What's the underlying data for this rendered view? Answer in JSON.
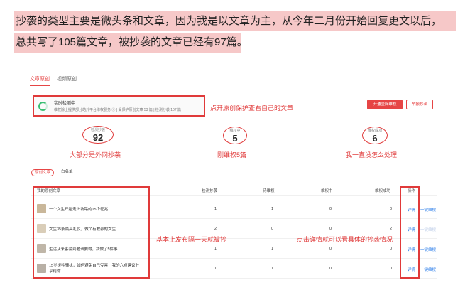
{
  "intro": {
    "line1": "抄袭的类型主要是微头条和文章，因为我是以文章为主，从今年二月份开始回复更文以后，",
    "line2": "总共写了105篇文章，被抄袭的文章已经有97篇。"
  },
  "tabs": [
    {
      "label": "文章原创",
      "active": true
    },
    {
      "label": "视频原创",
      "active": false
    }
  ],
  "monitor": {
    "title": "实时检测中",
    "desc": "维权除上提供部分站外平台维权服务 ⓘ  |  受保护原创文章 53 篇  |  检测抄袭 107 篇"
  },
  "annotations": {
    "top_right": "点开原创保护查看自己的文章",
    "stat1": "大部分是外网抄袭",
    "stat2": "刚维权5篇",
    "stat3": "我一直没怎么处理",
    "table_mid": "基本上发布隔一天就被抄",
    "table_right": "点击详情就可以看具体的抄袭情况"
  },
  "buttons": {
    "primary": "开通全网维权",
    "secondary": "举报抄袭"
  },
  "stats": [
    {
      "caption": "检测抄袭",
      "value": "92"
    },
    {
      "caption": "维权中",
      "value": "5"
    },
    {
      "caption": "维权成功",
      "value": "6"
    }
  ],
  "filters": {
    "original": "原创文章",
    "whitelist": "白名单"
  },
  "table": {
    "headers": {
      "article": "我的原创文章",
      "detected": "检测抄袭",
      "pending": "待维权",
      "in_progress": "维权中",
      "success": "维权成功",
      "actions": "操作"
    },
    "rows": [
      {
        "title": "一个女生开始走上坡路的15个征兆",
        "detected": "1",
        "pending": "1",
        "in_progress": "0",
        "success": "0",
        "detail": "详情",
        "action": "一键维权"
      },
      {
        "title": "女生35条最高礼仪，做个有教养的女生",
        "detected": "2",
        "pending": "0",
        "in_progress": "0",
        "success": "2",
        "detail": "详情",
        "action": "一键维权"
      },
      {
        "title": "生活从来客套到老谱要得，我做了5件事",
        "detected": "1",
        "pending": "1",
        "in_progress": "0",
        "success": "0",
        "detail": "详情",
        "action": "一键维权"
      },
      {
        "title": "15岁拔牲骚扰，如何避免自己受害，我的六点建议分享给你",
        "detected": "1",
        "pending": "1",
        "in_progress": "0",
        "success": "0",
        "detail": "详情",
        "action": "一键维权"
      }
    ]
  },
  "colors": {
    "accent": "#e64545",
    "highlight": "#f6c8c8",
    "link": "#1a73e8",
    "annotation": "#e03a3a"
  }
}
